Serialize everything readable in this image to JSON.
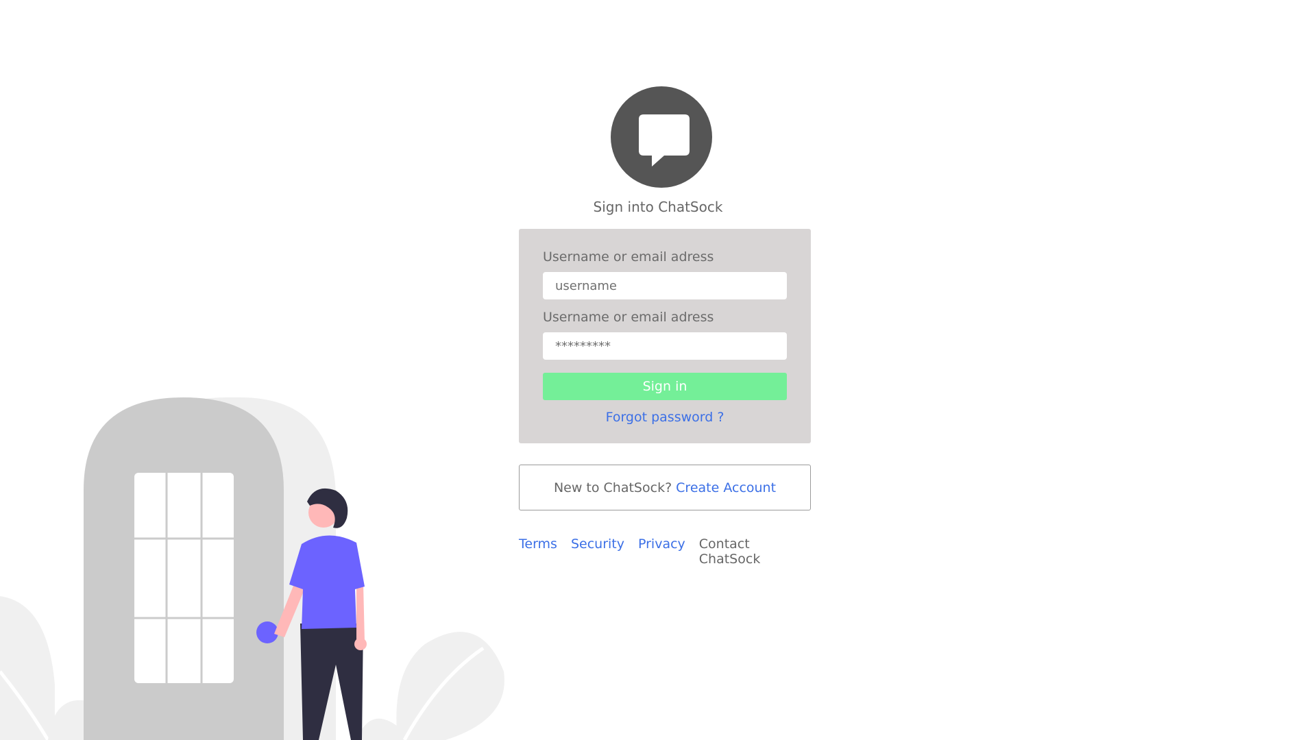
{
  "header": {
    "logo_icon": "chat-bubble-icon",
    "title": "Sign into ChatSock"
  },
  "login_form": {
    "username_label": "Username or email adress",
    "username_placeholder": "username",
    "password_label": "Username or email adress",
    "password_placeholder": "*********",
    "signin_label": "Sign in",
    "forgot_label": "Forgot password ?"
  },
  "signup": {
    "prompt": "New to ChatSock?",
    "link_label": "Create Account"
  },
  "footer": {
    "terms": "Terms",
    "security": "Security",
    "privacy": "Privacy",
    "contact": "Contact ChatSock"
  },
  "colors": {
    "card_bg": "#d8d5d5",
    "button_bg": "#74ef98",
    "link": "#3b6fe6",
    "logo_circle": "#555555",
    "shirt": "#6c63ff"
  }
}
